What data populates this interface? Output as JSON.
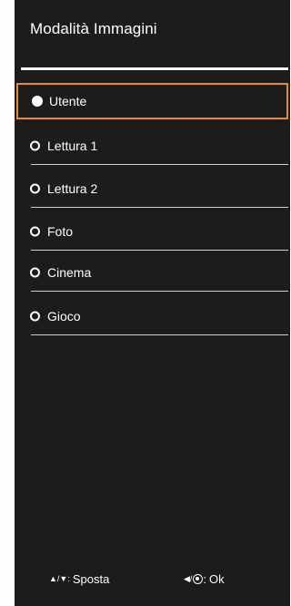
{
  "menu": {
    "title": "Modalità Immagini",
    "options": [
      {
        "label": "Utente",
        "selected": true
      },
      {
        "label": "Lettura 1",
        "selected": false
      },
      {
        "label": "Lettura 2",
        "selected": false
      },
      {
        "label": "Foto",
        "selected": false
      },
      {
        "label": "Cinema",
        "selected": false
      },
      {
        "label": "Gioco",
        "selected": false
      }
    ]
  },
  "footer": {
    "move_keys": "▲/▼:",
    "move_label": "Sposta",
    "ok_keys_left": "◀/",
    "ok_keys_colon": ":",
    "ok_label": "Ok"
  },
  "colors": {
    "panel_background": "#1c1c1c",
    "focus_border": "#ef8a1e",
    "text": "#ffffff"
  },
  "icons": {
    "up_down": "up-down-arrow-icon",
    "left": "left-arrow-icon",
    "ok": "ok-button-icon"
  }
}
